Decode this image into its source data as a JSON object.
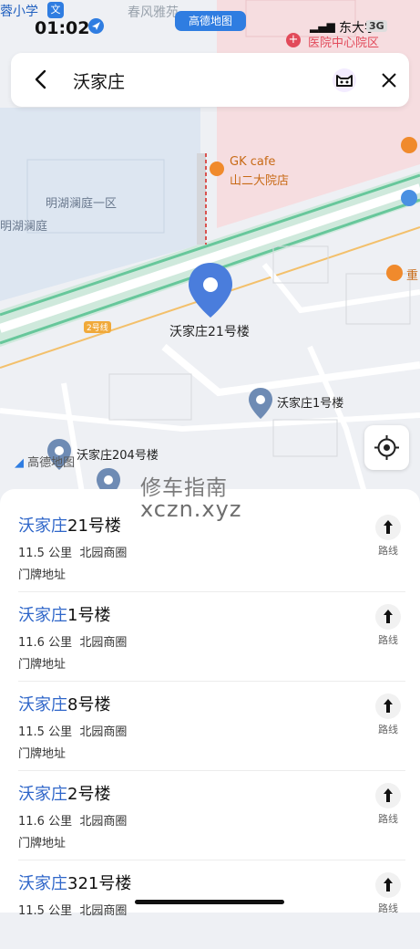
{
  "status_bar": {
    "time": "01:02",
    "school_label": "蓉小学",
    "school_badge": "文",
    "map_label_top": "春风雅苑",
    "amap_label": "高德地图",
    "hospital_label": "医院中心院区",
    "hospital_top": "东大学",
    "network": "3G"
  },
  "search": {
    "query": "沃家庄"
  },
  "map": {
    "poi_gk": "GK cafe",
    "poi_gk_sub": "山二大院店",
    "area_1": "明湖澜庭一区",
    "area_2": "明湖澜庭",
    "road_badge": "2号线",
    "main_pin": "沃家庄21号楼",
    "pin_1": "沃家庄1号楼",
    "pin_204": "沃家庄204号楼",
    "right_poi": "重",
    "amap_logo": "高德地图"
  },
  "watermark": {
    "line1": "修车指南",
    "line2": "xczn.xyz"
  },
  "results": [
    {
      "highlight": "沃家庄",
      "rest": "21号楼",
      "distance": "11.5 公里",
      "area": "北园商圈",
      "addr": "门牌地址",
      "route": "路线"
    },
    {
      "highlight": "沃家庄",
      "rest": "1号楼",
      "distance": "11.6 公里",
      "area": "北园商圈",
      "addr": "门牌地址",
      "route": "路线"
    },
    {
      "highlight": "沃家庄",
      "rest": "8号楼",
      "distance": "11.5 公里",
      "area": "北园商圈",
      "addr": "门牌地址",
      "route": "路线"
    },
    {
      "highlight": "沃家庄",
      "rest": "2号楼",
      "distance": "11.6 公里",
      "area": "北园商圈",
      "addr": "门牌地址",
      "route": "路线"
    },
    {
      "highlight": "沃家庄",
      "rest": "321号楼",
      "distance": "11.5 公里",
      "area": "北园商圈",
      "addr": "",
      "route": "路线"
    }
  ],
  "colors": {
    "accent": "#2f66c9",
    "pin": "#4a7ddc",
    "hospital": "#e24a5a"
  }
}
